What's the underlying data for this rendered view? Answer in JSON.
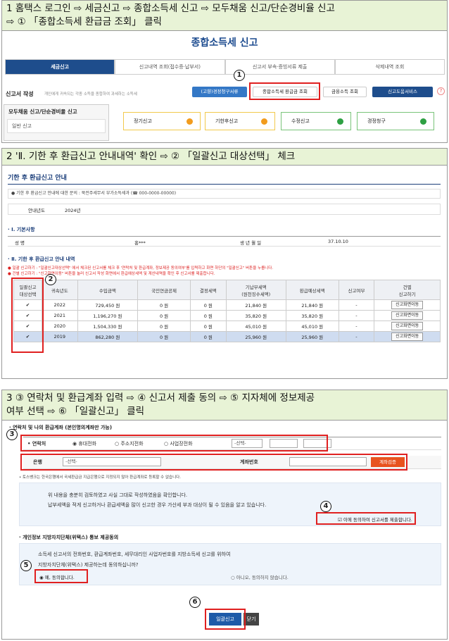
{
  "p1": {
    "step_text": "1 홈택스 로그인 ⇨ 세금신고 ⇨ 종합소득세 신고 ⇨ 모두채움 신고/단순경비율 신고",
    "step_text2": "⇨ ① 「종합소득세 환급금 조회」 클릭",
    "title": "종합소득세 신고",
    "tabs": [
      "세금신고",
      "신고내역 조회(접수증·납부서)",
      "신고서 부속·증빙서류 제출",
      "삭제내역 조회"
    ],
    "form_label": "신고서 작성",
    "form_desc": "개인에게 귀속되는 각종 소득을 종합하여 과세하는 소득세",
    "btns": [
      "(고향)경정청구서류",
      "종합소득세 환급금 조회",
      "금융소득 조회",
      "신고도움서비스"
    ],
    "left_item": "모두채움 신고/단순경비율 신고",
    "left_sub": "일반 신고",
    "cards": [
      "정기신고",
      "기한후신고",
      "수정신고",
      "경정청구"
    ]
  },
  "p2": {
    "step_text": "2 'Ⅱ. 기한 후 환급신고 안내내역' 확인 ⇨ ② 「일괄신고 대상선택」 체크",
    "title": "기한 후 환급신고 안내",
    "contact": "● 기한 후 환급신고 안내에 대한 문의 : 북전주세무서 부가소득세과 (☎ 000-0000-00000)",
    "year_label": "안내년도",
    "year_value": "2024년",
    "sec1": "· Ⅰ. 기본사항",
    "f_name": "성 명",
    "f_name_val": "홍***",
    "f_birth": "생 년 월 일",
    "f_birth_val": "37.10.10",
    "sec2": "· Ⅱ. 기한 후 환급신고 안내 내역",
    "note1": "● 일괄 신고하기 : \"일괄신고대상선택\" 에서 체크된 신고서를 체크 후 '연락처 및 환급계좌, 정보제공 동의여부'를 입력하고 화면 하단의 \"일괄신고\" 버튼을 누릅니다.",
    "note2": "● 건별 신고하기 : \"신고화면이동\" 버튼을 눌러 신고서 작성 화면에서 환급예상세액 및 계산내역을 확인 후 신고서를 제출합니다.",
    "headers": [
      "일괄신고\n대상선택",
      "귀속년도",
      "수입금액",
      "국민연금공제",
      "결정세액",
      "기납부세액\n(원천징수세액)",
      "환급예상세액",
      "신고여부",
      "건별\n신고하기"
    ],
    "rows": [
      [
        "2022",
        "729,450 원",
        "0 원",
        "0 원",
        "21,840 원",
        "21,840 원",
        "-"
      ],
      [
        "2021",
        "1,196,270 원",
        "0 원",
        "0 원",
        "35,820 원",
        "35,820 원",
        "-"
      ],
      [
        "2020",
        "1,504,330 원",
        "0 원",
        "0 원",
        "45,010 원",
        "45,010 원",
        "-"
      ],
      [
        "2019",
        "862,280 원",
        "0 원",
        "0 원",
        "25,960 원",
        "25,960 원",
        "-"
      ]
    ],
    "row_btn": "신고화면이동"
  },
  "p3": {
    "step_text": "3 ③ 연락처 및 환급계좌 입력 ⇨ ④ 신고서 제출 동의 ⇨ ⑤ 지자체에 정보제공",
    "step_text2": "여부 선택 ⇨ ⑥ 「일괄신고」 클릭",
    "sec1": "· 연락처 및 나의 환급계좌 (본인명의계좌만 가능)",
    "contact_label": "• 연락처",
    "radios": [
      "휴대전화",
      "주소지전화",
      "사업장전화"
    ],
    "select_ph": "-선택-",
    "bank_label": "은행",
    "bank_select": "-선택-",
    "acct_label": "계좌번호",
    "verify": "계좌검증",
    "bank_note": "• 토스뱅크는 한국은행에서 국세환급금 지급은행으로 지정되지 않아 환급계좌로 등록할 수 없습니다.",
    "agree_text1": "위 내용을 충분히 검토하였고 사실 그대로 작성하였음을 확인합니다.",
    "agree_text2": "납부세액을 적게 신고하거나 환급세액을 많이 신고한 경우 가산세 부과 대상이 될 수 있음을 알고 있습니다.",
    "agree_check": "이에 동의하여 신고서를 제출합니다.",
    "sec2": "· 개인정보 지방자치단체(위택스) 통보 제공동의",
    "consent1": "소득세 신고서의 전화번호, 환급계좌번호, 세무대리인 사업자번호를 지방소득세 신고를 위하여",
    "consent2": "지방자치단체(위택스) 제공하는데 동의하십니까?",
    "yes": "예, 동의합니다.",
    "no": "아니오, 동의하지 않습니다.",
    "submit": "일괄신고",
    "close": "닫기"
  }
}
